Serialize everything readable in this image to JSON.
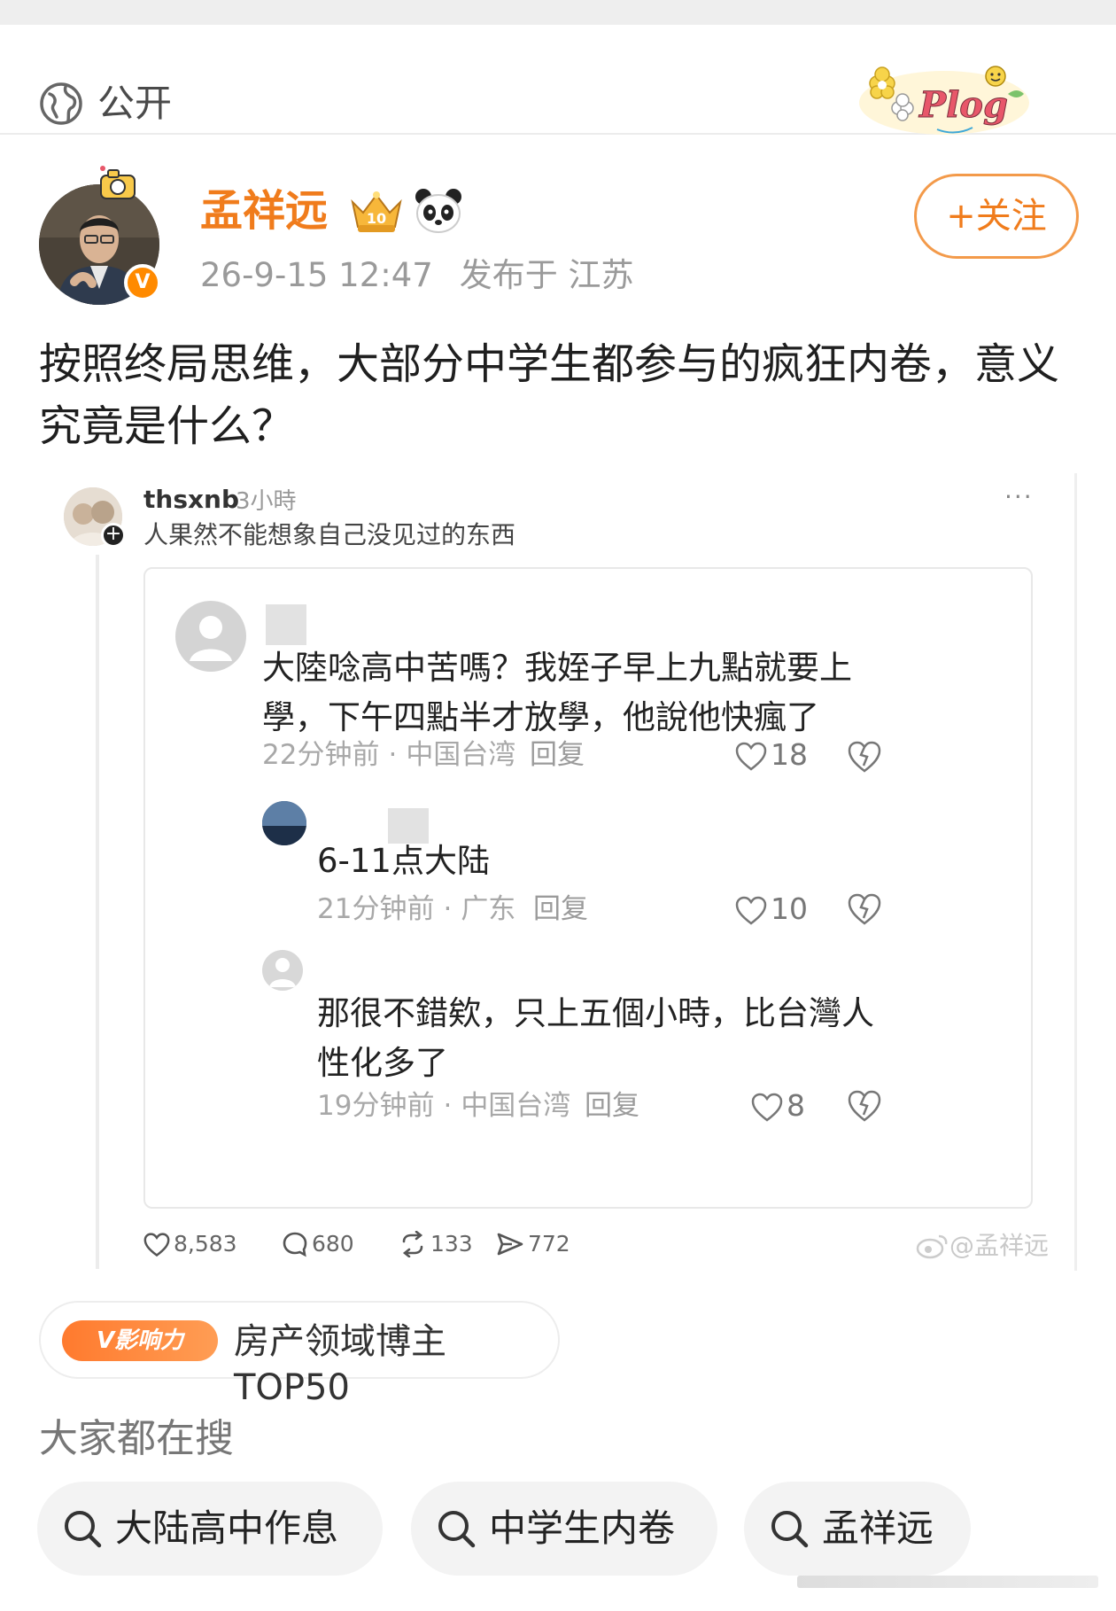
{
  "visibility": {
    "label": "公开",
    "icon": "globe-icon"
  },
  "sticker": {
    "text": "Plog"
  },
  "author": {
    "name": "孟祥远",
    "badge": "V",
    "crown_level": "10",
    "date": "26-9-15 12:47",
    "location": "发布于 江苏",
    "follow_label": "+关注"
  },
  "post": {
    "text": "按照终局思维，大部分中学生都参与的疯狂内卷，意义究竟是什么？"
  },
  "screenshot": {
    "thread": {
      "username": "thsxnb",
      "time": "3小時",
      "text": "人果然不能想象自己没见过的东西",
      "more": "···"
    },
    "comments": [
      {
        "text": "大陸唸高中苦嗎？我姪子早上九點就要上學，下午四點半才放學，他說他快瘋了",
        "time": "22分钟前",
        "region": "中国台湾",
        "reply": "回复",
        "likes": "18"
      },
      {
        "text": "6-11点大陆",
        "time": "21分钟前",
        "region": "广东",
        "reply": "回复",
        "likes": "10"
      },
      {
        "text": "那很不錯欸，只上五個小時，比台灣人性化多了",
        "time": "19分钟前",
        "region": "中国台湾",
        "reply": "回复",
        "likes": "8"
      }
    ],
    "actions": {
      "likes": "8,583",
      "comments": "680",
      "reposts": "133",
      "shares": "772"
    },
    "watermark": "@孟祥远"
  },
  "influence": {
    "badge": "V影响力",
    "text": "房产领域博主TOP50"
  },
  "search": {
    "title": "大家都在搜",
    "items": [
      "大陆高中作息",
      "中学生内卷",
      "孟祥远"
    ]
  },
  "colors": {
    "accent": "#f07c1c",
    "text": "#222222",
    "muted": "#9a9a9a"
  }
}
